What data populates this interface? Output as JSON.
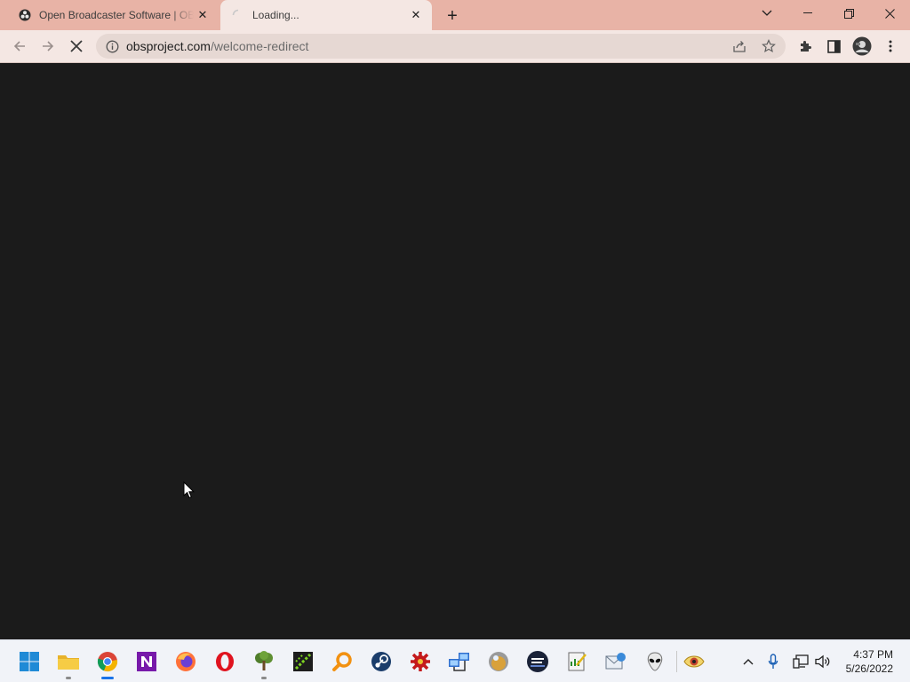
{
  "browser": {
    "tabs": [
      {
        "title": "Open Broadcaster Software | OBS",
        "state": "inactive",
        "icon": "obs-icon"
      },
      {
        "title": "Loading...",
        "state": "active",
        "icon": "loading-spinner-icon"
      }
    ],
    "new_tab_label": "+",
    "address": {
      "host": "obsproject.com",
      "path": "/welcome-redirect"
    }
  },
  "taskbar": {
    "apps": [
      {
        "name": "start",
        "icon": "windows-start-icon"
      },
      {
        "name": "file-explorer",
        "icon": "folder-icon",
        "running": true
      },
      {
        "name": "chrome",
        "icon": "chrome-icon",
        "running": true,
        "active": true
      },
      {
        "name": "onenote",
        "icon": "onenote-icon"
      },
      {
        "name": "firefox",
        "icon": "firefox-icon"
      },
      {
        "name": "opera",
        "icon": "opera-icon"
      },
      {
        "name": "tree-app",
        "icon": "tree-icon",
        "running": true
      },
      {
        "name": "green-app",
        "icon": "green-grid-icon"
      },
      {
        "name": "search-app",
        "icon": "magnifier-icon"
      },
      {
        "name": "steam",
        "icon": "steam-icon"
      },
      {
        "name": "puzzle-app",
        "icon": "red-gear-icon"
      },
      {
        "name": "network-app",
        "icon": "network-computers-icon"
      },
      {
        "name": "orb-app",
        "icon": "orb-icon"
      },
      {
        "name": "infra-app",
        "icon": "infra-badge-icon"
      },
      {
        "name": "notepad-app",
        "icon": "notepad-chart-icon"
      },
      {
        "name": "mail-app",
        "icon": "mail-globe-icon"
      },
      {
        "name": "alien-app",
        "icon": "alien-icon"
      },
      {
        "name": "eye-app",
        "icon": "eye-icon"
      }
    ],
    "clock": {
      "time": "4:37 PM",
      "date": "5/26/2022"
    }
  }
}
